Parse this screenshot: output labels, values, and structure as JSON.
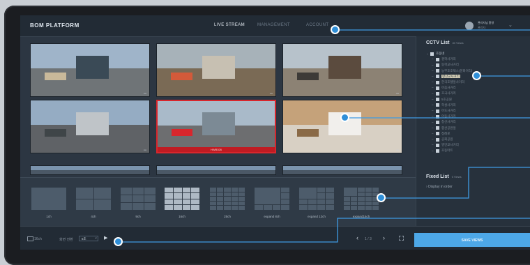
{
  "app": {
    "title": "BOM PLATFORM"
  },
  "nav": [
    {
      "label": "LIVE STREAM",
      "active": true
    },
    {
      "label": "MANAGEMENT",
      "active": false
    },
    {
      "label": "ACCOUNT",
      "active": false
    }
  ],
  "user": {
    "name": "관리자님 환영",
    "role": "관리자"
  },
  "cameras": [
    {
      "scene": "bus-stop"
    },
    {
      "scene": "construction"
    },
    {
      "scene": "hanok-courtyard"
    },
    {
      "scene": "road-shelter"
    },
    {
      "scene": "bus-shelter",
      "selected": true,
      "label": "HWB026"
    },
    {
      "scene": "indoor-hall"
    },
    {
      "scene": "partial"
    },
    {
      "scene": "partial"
    },
    {
      "scene": "partial"
    }
  ],
  "cctv_panel": {
    "title": "CCTV List",
    "count": "40 Views",
    "tree": [
      {
        "label": "호동네",
        "level": 0,
        "expanded": true
      },
      {
        "label": "경학사거리",
        "level": 1
      },
      {
        "label": "동학교사거리",
        "level": 1
      },
      {
        "label": "농부호호택스(문화거리)",
        "level": 1
      },
      {
        "label": "향산교사거리",
        "level": 1,
        "highlight": true
      },
      {
        "label": "한국호텔앞사거리",
        "level": 1
      },
      {
        "label": "어음사거리",
        "level": 1
      },
      {
        "label": "호국사거리",
        "level": 1
      },
      {
        "label": "5호공원",
        "level": 1
      },
      {
        "label": "학성사거리",
        "level": 1
      },
      {
        "label": "어도사거리",
        "level": 1
      },
      {
        "label": "어동사거리",
        "level": 1
      },
      {
        "label": "창산사거리",
        "level": 1
      },
      {
        "label": "향산공원앞",
        "level": 1
      },
      {
        "label": "정례로",
        "level": 1
      },
      {
        "label": "공회공원",
        "level": 1
      },
      {
        "label": "명안교사거리",
        "level": 1
      },
      {
        "label": "호동마트",
        "level": 1
      }
    ]
  },
  "fixed_panel": {
    "title": "Fixed List",
    "count": "0 Views",
    "sub": "Display in order"
  },
  "layouts": [
    {
      "label": "1ch",
      "cols": 1,
      "rows": 1
    },
    {
      "label": "4ch",
      "cols": 2,
      "rows": 2
    },
    {
      "label": "9ch",
      "cols": 3,
      "rows": 3
    },
    {
      "label": "16ch",
      "cols": 4,
      "rows": 4,
      "active": true
    },
    {
      "label": "25ch",
      "cols": 5,
      "rows": 5
    },
    {
      "label": "expand 8ch",
      "cols": 4,
      "rows": 4,
      "type": "expand8"
    },
    {
      "label": "expand 12ch",
      "cols": 4,
      "rows": 4,
      "type": "expand12"
    },
    {
      "label": "expand16ch",
      "cols": 5,
      "rows": 5,
      "type": "expand16"
    }
  ],
  "bottombar": {
    "channel": "16ch",
    "speed_label": "화면 전환",
    "speed_value": "5초",
    "page": "1 / 3",
    "save_label": "SAVE VIEWS"
  },
  "colors": {
    "accent": "#4da8e8",
    "selected": "#d8262c",
    "background": "#2c3642"
  }
}
